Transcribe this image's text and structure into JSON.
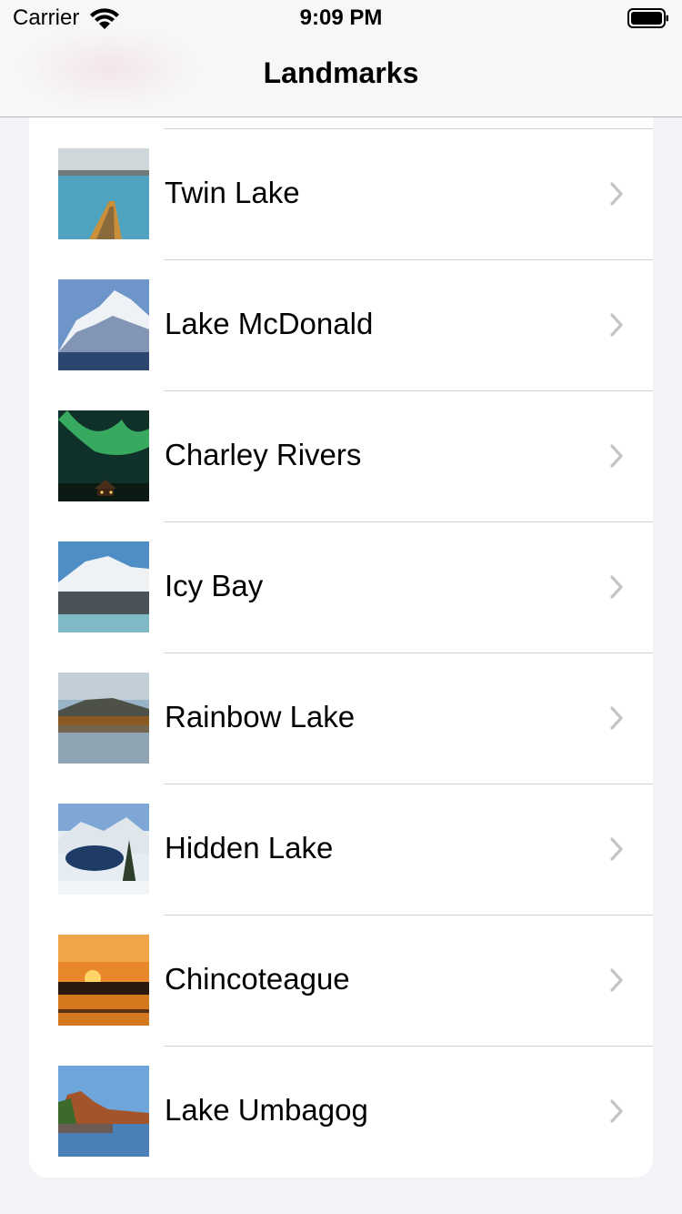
{
  "status_bar": {
    "carrier": "Carrier",
    "time": "9:09 PM",
    "icons": [
      "wifi-icon",
      "battery-icon"
    ]
  },
  "nav": {
    "title": "Landmarks"
  },
  "landmarks": [
    {
      "name": "Twin Lake",
      "thumb_icon": "twin-lake-thumbnail"
    },
    {
      "name": "Lake McDonald",
      "thumb_icon": "lake-mcdonald-thumbnail"
    },
    {
      "name": "Charley Rivers",
      "thumb_icon": "charley-rivers-thumbnail"
    },
    {
      "name": "Icy Bay",
      "thumb_icon": "icy-bay-thumbnail"
    },
    {
      "name": "Rainbow Lake",
      "thumb_icon": "rainbow-lake-thumbnail"
    },
    {
      "name": "Hidden Lake",
      "thumb_icon": "hidden-lake-thumbnail"
    },
    {
      "name": "Chincoteague",
      "thumb_icon": "chincoteague-thumbnail"
    },
    {
      "name": "Lake Umbagog",
      "thumb_icon": "lake-umbagog-thumbnail"
    }
  ],
  "colors": {
    "background": "#f2f2f7",
    "separator": "#d1d1d6",
    "chevron": "#c4c4c7"
  }
}
